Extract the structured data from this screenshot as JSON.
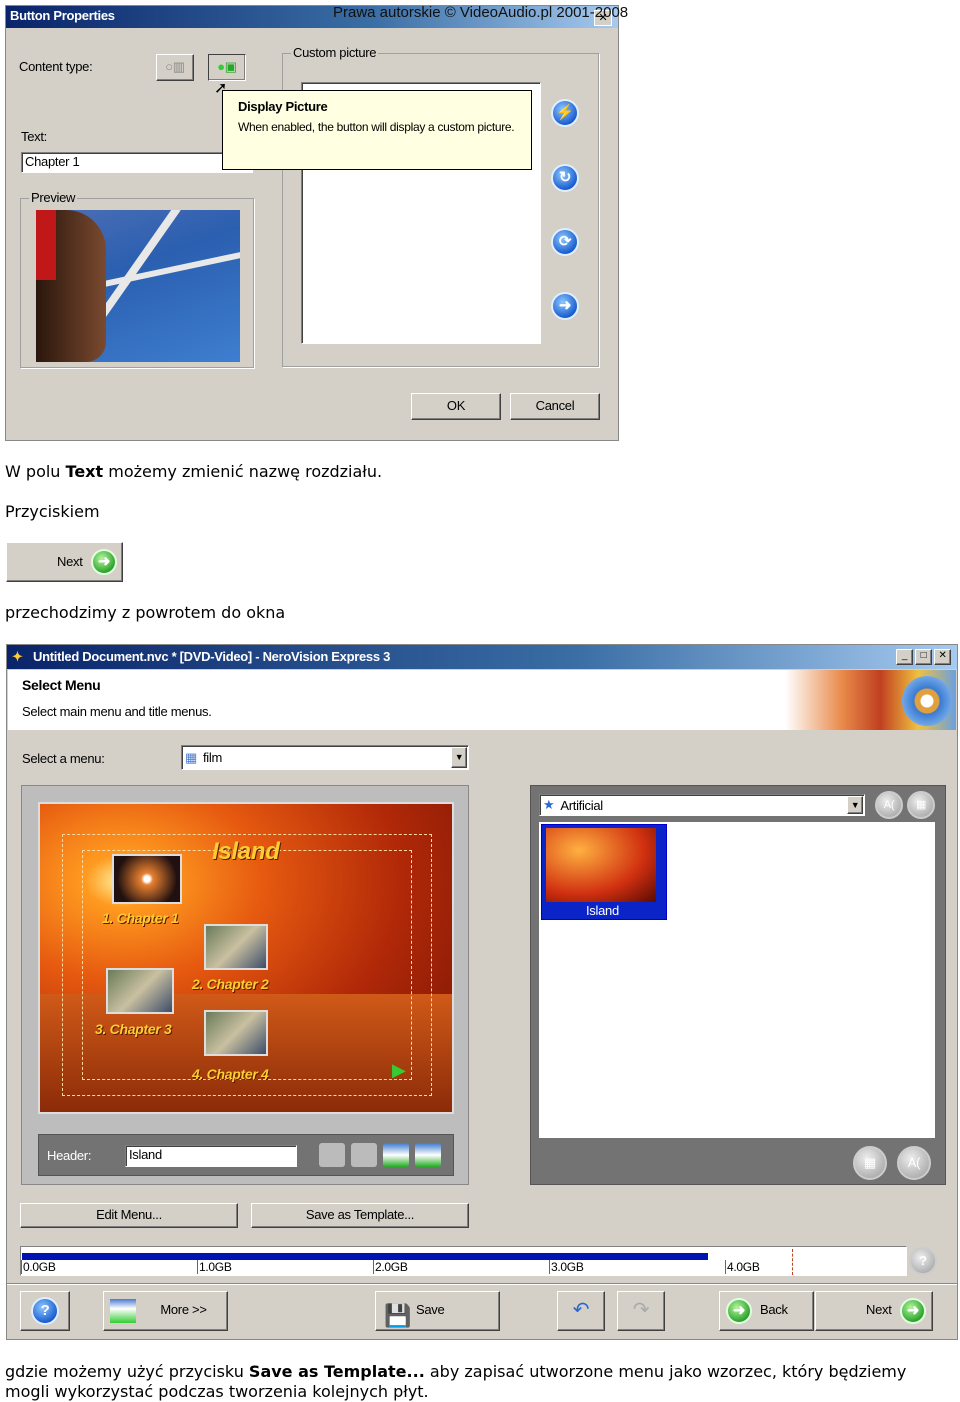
{
  "dialog": {
    "title": "Button Properties",
    "copyright": "Prawa autorskie © VideoAudio.pl 2001-2008",
    "content_type_label": "Content type:",
    "text_label": "Text:",
    "text_value": "Chapter 1",
    "preview_label": "Preview",
    "custom_picture_label": "Custom picture",
    "tooltip_title": "Display Picture",
    "tooltip_text": "When enabled, the button will display a custom picture.",
    "ok": "OK",
    "cancel": "Cancel"
  },
  "doc": {
    "p1_pre": "W polu ",
    "p1_bold": "Text",
    "p1_post": " możemy zmienić nazwę rozdziału.",
    "p2": "Przyciskiem",
    "next_btn": "Next",
    "p3": "przechodzimy z powrotem do okna",
    "p4_pre": "gdzie możemy użyć przycisku ",
    "p4_bold": "Save as Template...",
    "p4_post": " aby zapisać utworzone menu jako wzorzec, który będziemy mogli wykorzystać podczas tworzenia kolejnych płyt."
  },
  "app": {
    "title": "Untitled Document.nvc * [DVD-Video] - NeroVision Express 3",
    "heading": "Select Menu",
    "subheading": "Select main menu and title menus.",
    "select_menu_label": "Select a menu:",
    "select_menu_value": "film",
    "menu_preview": {
      "title": "Island",
      "chapters": [
        "1. Chapter 1",
        "2. Chapter 2",
        "3. Chapter 3",
        "4. Chapter 4"
      ]
    },
    "header_label": "Header:",
    "header_value": "Island",
    "template_select": "Artificial",
    "template_item": "Island",
    "edit_menu": "Edit Menu...",
    "save_template": "Save as Template...",
    "disk": {
      "ticks": [
        "0.0GB",
        "1.0GB",
        "2.0GB",
        "3.0GB",
        "4.0GB"
      ],
      "used_gb": 3.9,
      "capacity_gb": 4.38,
      "bar_color": "#0014b4"
    },
    "more": "More >>",
    "save": "Save",
    "back": "Back",
    "next": "Next"
  }
}
